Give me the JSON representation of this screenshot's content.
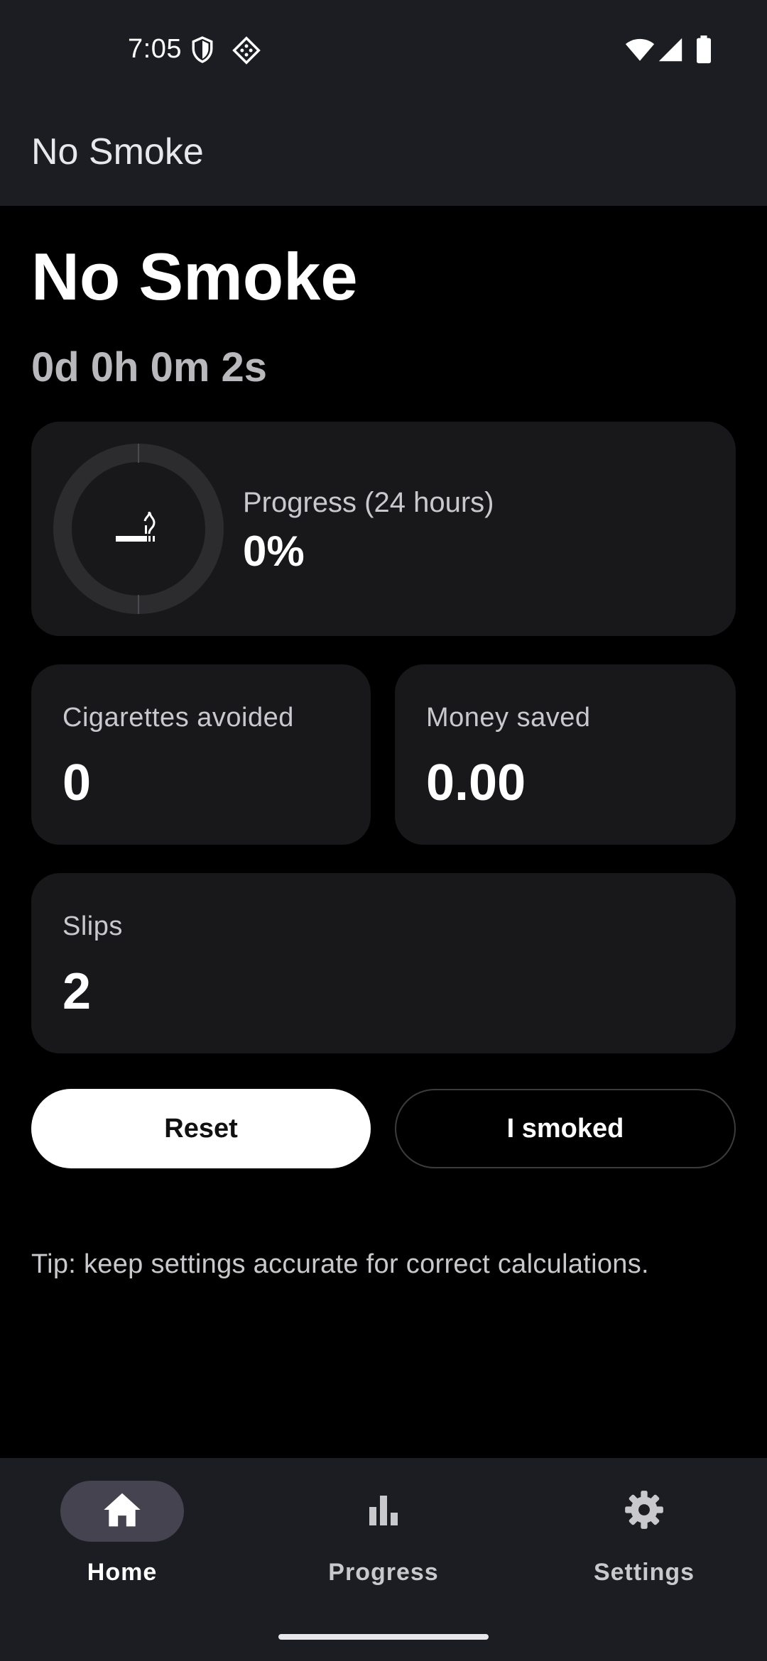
{
  "status_bar": {
    "time": "7:05",
    "icons": [
      "shield-icon",
      "game-controller-icon",
      "wifi-icon",
      "signal-icon",
      "battery-icon"
    ]
  },
  "app_bar": {
    "title": "No Smoke"
  },
  "main": {
    "title": "No Smoke",
    "timer": "0d 0h 0m 2s",
    "progress_card": {
      "label": "Progress (24 hours)",
      "value": "0%",
      "fraction": 0,
      "icon": "smoking-icon"
    },
    "cigarettes_card": {
      "label": "Cigarettes avoided",
      "value": "0"
    },
    "money_card": {
      "label": "Money saved",
      "value": "0.00"
    },
    "slips_card": {
      "label": "Slips",
      "value": "2"
    },
    "reset_label": "Reset",
    "smoked_label": "I smoked",
    "tip": "Tip: keep settings accurate for correct calculations."
  },
  "bottom_nav": {
    "items": [
      {
        "label": "Home",
        "icon": "home-icon",
        "active": true
      },
      {
        "label": "Progress",
        "icon": "bar-chart-icon",
        "active": false
      },
      {
        "label": "Settings",
        "icon": "gear-icon",
        "active": false
      }
    ]
  },
  "colors": {
    "background": "#000000",
    "surface": "#1c1d22",
    "card": "#18181a",
    "nav_active_pill": "#44434f",
    "primary_button": "#ffffff"
  }
}
